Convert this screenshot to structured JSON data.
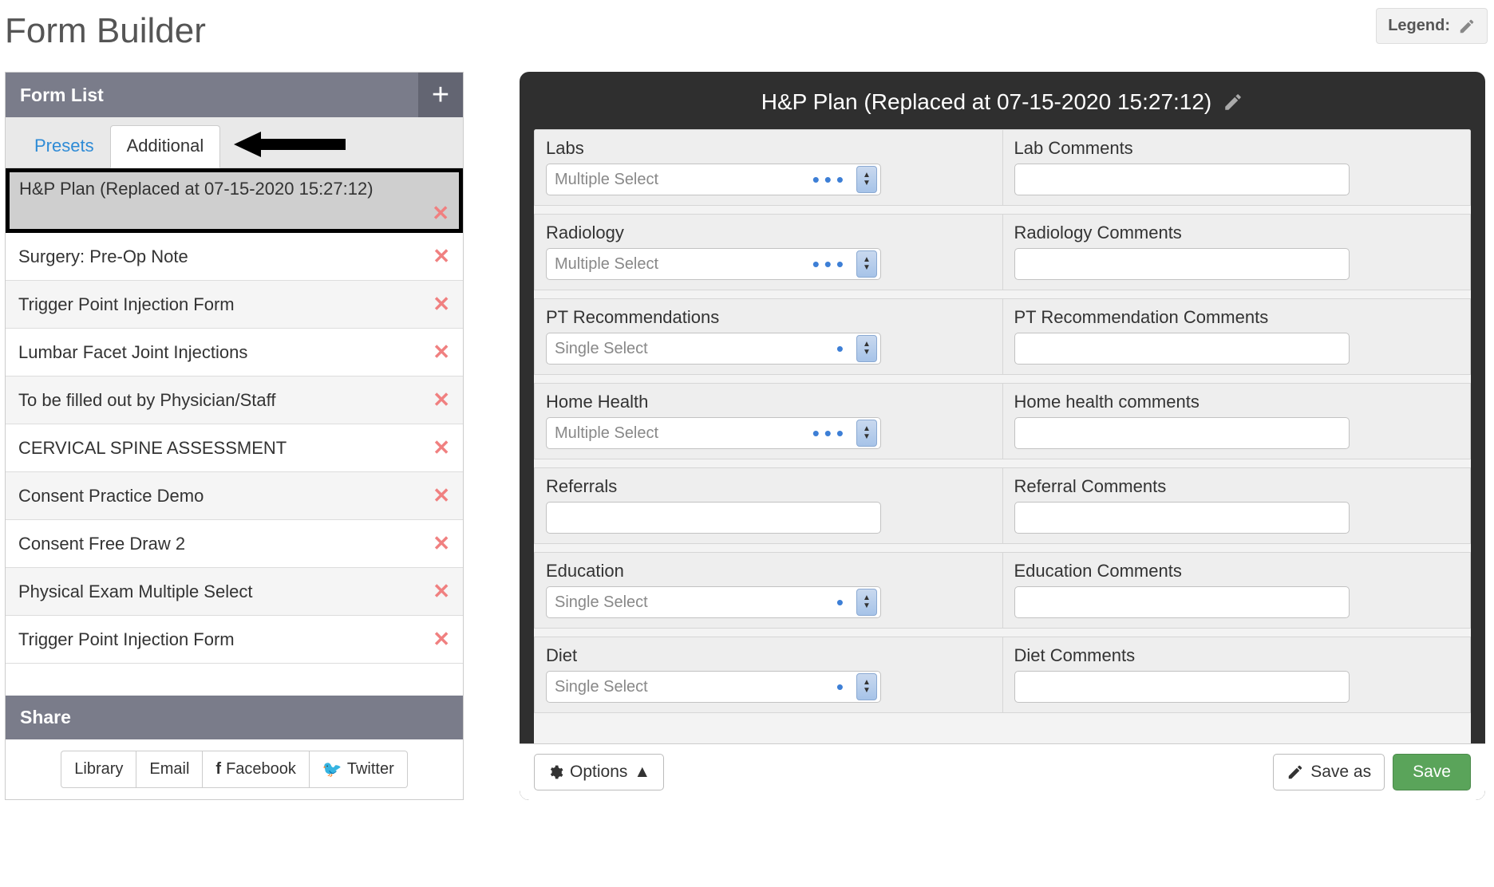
{
  "pageTitle": "Form Builder",
  "legendLabel": "Legend:",
  "leftPanel": {
    "headerTitle": "Form List",
    "tabs": {
      "presets": "Presets",
      "additional": "Additional",
      "active": "additional"
    },
    "items": [
      {
        "label": "H&P Plan (Replaced at 07-15-2020 15:27:12)",
        "selected": true
      },
      {
        "label": "Surgery: Pre-Op Note"
      },
      {
        "label": "Trigger Point Injection Form"
      },
      {
        "label": "Lumbar Facet Joint Injections"
      },
      {
        "label": "To be filled out by Physician/Staff"
      },
      {
        "label": "CERVICAL SPINE ASSESSMENT"
      },
      {
        "label": "Consent Practice Demo"
      },
      {
        "label": "Consent Free Draw 2"
      },
      {
        "label": "Physical Exam Multiple Select"
      },
      {
        "label": "Trigger Point Injection Form"
      }
    ],
    "shareLabel": "Share",
    "shareButtons": {
      "library": "Library",
      "email": "Email",
      "facebook": "Facebook",
      "twitter": "Twitter"
    }
  },
  "rightPanel": {
    "title": "H&P Plan (Replaced at 07-15-2020 15:27:12)",
    "selectPlaceholders": {
      "multiple": "Multiple Select",
      "single": "Single Select"
    },
    "rows": [
      {
        "left": {
          "label": "Labs",
          "type": "multiple"
        },
        "right": {
          "label": "Lab Comments",
          "type": "text"
        }
      },
      {
        "left": {
          "label": "Radiology",
          "type": "multiple"
        },
        "right": {
          "label": "Radiology Comments",
          "type": "text"
        }
      },
      {
        "left": {
          "label": "PT Recommendations",
          "type": "single"
        },
        "right": {
          "label": "PT Recommendation Comments",
          "type": "text"
        }
      },
      {
        "left": {
          "label": "Home Health",
          "type": "multiple"
        },
        "right": {
          "label": "Home health comments",
          "type": "text"
        }
      },
      {
        "left": {
          "label": "Referrals",
          "type": "text"
        },
        "right": {
          "label": "Referral Comments",
          "type": "text"
        }
      },
      {
        "left": {
          "label": "Education",
          "type": "single"
        },
        "right": {
          "label": "Education Comments",
          "type": "text"
        }
      },
      {
        "left": {
          "label": "Diet",
          "type": "single"
        },
        "right": {
          "label": "Diet Comments",
          "type": "text"
        }
      }
    ],
    "footer": {
      "options": "Options",
      "saveAs": "Save as",
      "save": "Save"
    }
  }
}
